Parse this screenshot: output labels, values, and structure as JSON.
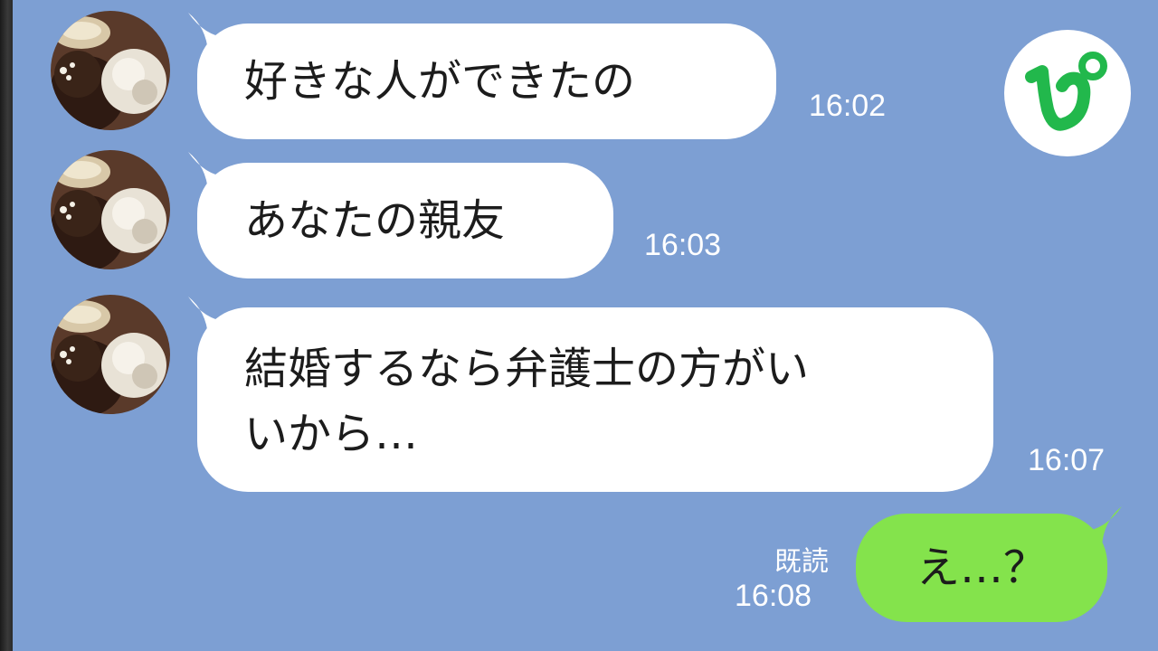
{
  "messages": [
    {
      "text": "好きな人ができたの",
      "time": "16:02"
    },
    {
      "text": "あなたの親友",
      "time": "16:03"
    },
    {
      "text_line1": "結婚するなら弁護士の方がい",
      "text_line2": "いから…",
      "time": "16:07"
    }
  ],
  "outgoing": {
    "text": "え…？",
    "read_label": "既読",
    "time": "16:08"
  },
  "badge": {
    "glyph": "ぴ",
    "color": "#22b84c"
  },
  "colors": {
    "background": "#7d9fd3",
    "incoming_bubble": "#ffffff",
    "outgoing_bubble": "#84e34c"
  },
  "icons": [
    "avatar-chocolate-icon",
    "app-badge-icon"
  ]
}
